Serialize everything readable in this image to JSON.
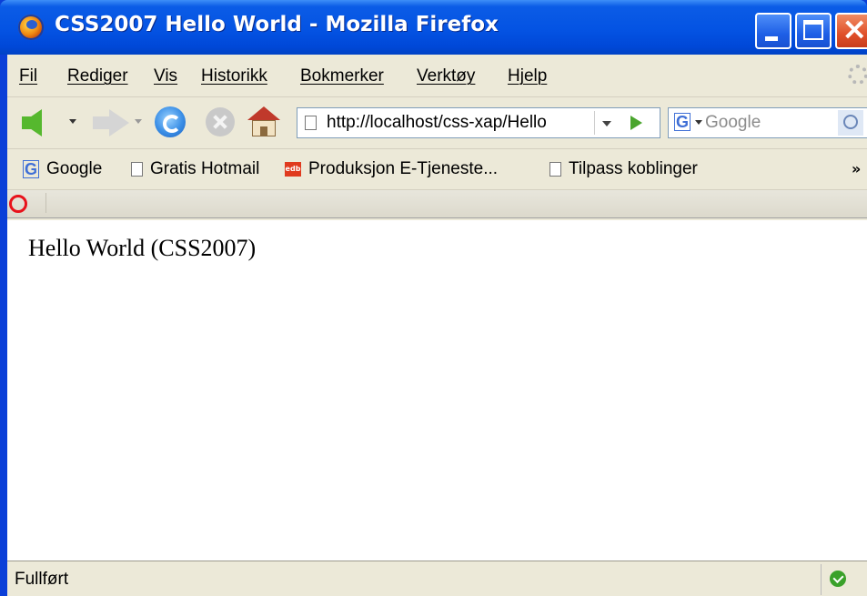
{
  "window": {
    "title": "CSS2007 Hello World - Mozilla Firefox"
  },
  "menubar": {
    "items": [
      "Fil",
      "Rediger",
      "Vis",
      "Historikk",
      "Bokmerker",
      "Verktøy",
      "Hjelp"
    ]
  },
  "navbar": {
    "url": "http://localhost/css-xap/Hello",
    "search_placeholder": "Google",
    "search_engine_glyph": "G",
    "icons": [
      "back-icon",
      "forward-icon",
      "reload-icon",
      "stop-icon",
      "home-icon",
      "go-icon",
      "search-icon"
    ]
  },
  "bookmarks": {
    "items": [
      {
        "label": "Google",
        "icon": "google-icon"
      },
      {
        "label": "Gratis Hotmail",
        "icon": "page-icon"
      },
      {
        "label": "Produksjon E-Tjeneste...",
        "icon": "edb-icon"
      },
      {
        "label": "Tilpass koblinger",
        "icon": "page-icon"
      }
    ],
    "more": "»"
  },
  "page": {
    "text": "Hello World (CSS2007)"
  },
  "status": {
    "text": "Fullført"
  },
  "colors": {
    "titlebar": "#0453e3",
    "chrome": "#ece9d8",
    "status_ok": "#3aa12a",
    "addon_ring": "#e8121b"
  }
}
